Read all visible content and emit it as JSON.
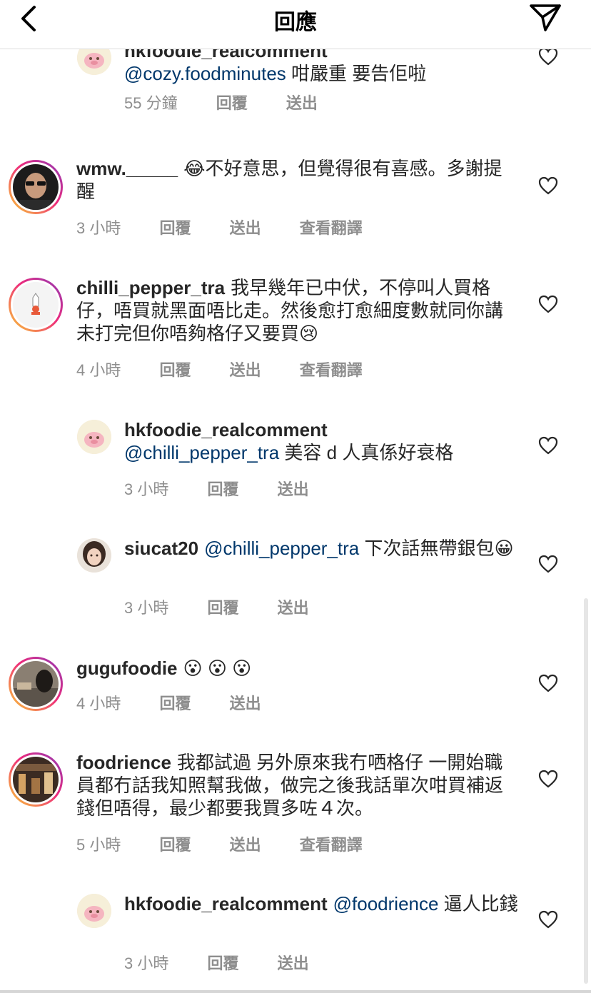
{
  "header": {
    "title": "回應",
    "back_icon": "chevron-left-icon",
    "share_icon": "paper-plane-icon"
  },
  "comments": [
    {
      "username": "hkfoodie_realcomment",
      "mention": "@cozy.foodminutes",
      "text": " 咁嚴重 要告佢啦",
      "time": "55 分鐘",
      "reply": "回覆",
      "send": "送出",
      "translate": ""
    },
    {
      "username": "wmw._____",
      "mention": "",
      "text": "😂不好意思，但覺得很有喜感。多謝提醒",
      "time": "3 小時",
      "reply": "回覆",
      "send": "送出",
      "translate": "查看翻譯"
    },
    {
      "username": "chilli_pepper_tra",
      "mention": "",
      "text": "我早幾年已中伏，不停叫人買格仔，唔買就黑面唔比走。然後愈打愈細度數就同你講未打完但你唔夠格仔又要買😢",
      "time": "4 小時",
      "reply": "回覆",
      "send": "送出",
      "translate": "查看翻譯"
    },
    {
      "username": "hkfoodie_realcomment",
      "mention": "@chilli_pepper_tra",
      "text": " 美容 d 人真係好衰格",
      "time": "3 小時",
      "reply": "回覆",
      "send": "送出",
      "translate": ""
    },
    {
      "username": "siucat20",
      "mention": "@chilli_pepper_tra",
      "text": " 下次話無帶銀包😀",
      "time": "3 小時",
      "reply": "回覆",
      "send": "送出",
      "translate": ""
    },
    {
      "username": "gugufoodie",
      "mention": "",
      "text": "😮 😮 😮",
      "time": "4 小時",
      "reply": "回覆",
      "send": "送出",
      "translate": ""
    },
    {
      "username": "foodrience",
      "mention": "",
      "text": "我都試過 另外原來我冇哂格仔 一開始職員都冇話我知照幫我做，做完之後我話單次咁買補返錢但唔得，最少都要我買多咗４次。",
      "time": "5 小時",
      "reply": "回覆",
      "send": "送出",
      "translate": "查看翻譯"
    },
    {
      "username": "hkfoodie_realcomment",
      "mention": "@foodrience",
      "text": " 逼人比錢",
      "time": "3 小時",
      "reply": "回覆",
      "send": "送出",
      "translate": ""
    }
  ],
  "icons": {
    "like": "heart-outline-icon"
  },
  "colors": {
    "mention": "#00376b",
    "meta": "#8e8e8e",
    "divider": "#dbdbdb"
  }
}
